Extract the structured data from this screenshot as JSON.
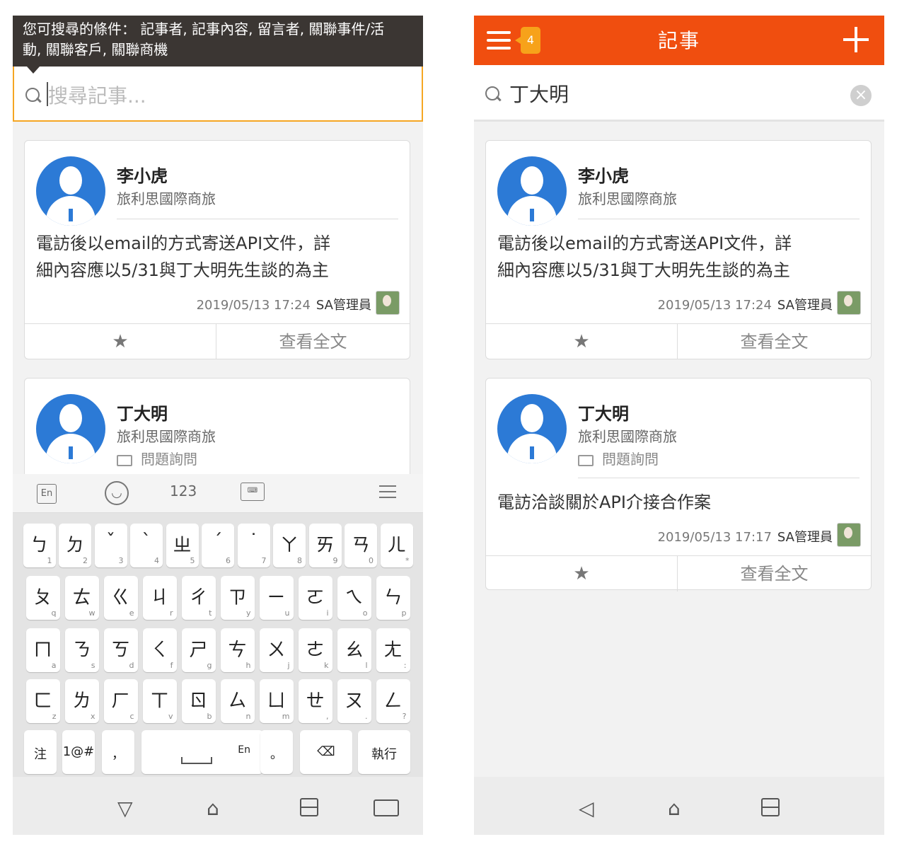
{
  "tooltip": {
    "line1": "您可搜尋的條件： 記事者, 記事內容, 留言者, 關聯事件/活",
    "line2": "動, 關聯客戶, 關聯商機"
  },
  "appbar": {
    "title": "記事",
    "badge_count": "4"
  },
  "search": {
    "placeholder": "搜尋記事...",
    "value": "丁大明"
  },
  "cards": [
    {
      "name": "李小虎",
      "company": "旅利思國際商旅",
      "content_line1": "電訪後以email的方式寄送API文件，詳",
      "content_line2": "細內容應以5/31與丁大明先生談的為主",
      "timestamp": "2019/05/13 17:24",
      "author": "SA管理員",
      "view_all": "查看全文"
    },
    {
      "name": "丁大明",
      "company": "旅利思國際商旅",
      "category": "問題詢問",
      "content_line1": "電訪洽談關於API介接合作案",
      "timestamp": "2019/05/13 17:17",
      "author": "SA管理員",
      "view_all": "查看全文"
    }
  ],
  "keyboard": {
    "toolbar": {
      "en": "En",
      "numbers": "123"
    },
    "rows": [
      [
        [
          "ㄅ",
          "1"
        ],
        [
          "ㄉ",
          "2"
        ],
        [
          "ˇ",
          "3"
        ],
        [
          "ˋ",
          "4"
        ],
        [
          "ㄓ",
          "5"
        ],
        [
          "ˊ",
          "6"
        ],
        [
          "˙",
          "7"
        ],
        [
          "ㄚ",
          "8"
        ],
        [
          "ㄞ",
          "9"
        ],
        [
          "ㄢ",
          "0"
        ],
        [
          "ㄦ",
          "*"
        ]
      ],
      [
        [
          "ㄆ",
          "q"
        ],
        [
          "ㄊ",
          "w"
        ],
        [
          "ㄍ",
          "e"
        ],
        [
          "ㄐ",
          "r"
        ],
        [
          "ㄔ",
          "t"
        ],
        [
          "ㄗ",
          "y"
        ],
        [
          "ㄧ",
          "u"
        ],
        [
          "ㄛ",
          "i"
        ],
        [
          "ㄟ",
          "o"
        ],
        [
          "ㄣ",
          "p"
        ]
      ],
      [
        [
          "ㄇ",
          "a"
        ],
        [
          "ㄋ",
          "s"
        ],
        [
          "ㄎ",
          "d"
        ],
        [
          "ㄑ",
          "f"
        ],
        [
          "ㄕ",
          "g"
        ],
        [
          "ㄘ",
          "h"
        ],
        [
          "ㄨ",
          "j"
        ],
        [
          "ㄜ",
          "k"
        ],
        [
          "ㄠ",
          "l"
        ],
        [
          "ㄤ",
          ":"
        ]
      ],
      [
        [
          "ㄈ",
          "z"
        ],
        [
          "ㄌ",
          "x"
        ],
        [
          "ㄏ",
          "c"
        ],
        [
          "ㄒ",
          "v"
        ],
        [
          "ㄖ",
          "b"
        ],
        [
          "ㄙ",
          "n"
        ],
        [
          "ㄩ",
          "m"
        ],
        [
          "ㄝ",
          ","
        ],
        [
          "ㄡ",
          "."
        ],
        [
          "ㄥ",
          "?"
        ]
      ]
    ],
    "bottom": {
      "zhuyin": "注",
      "symbols": "1@#",
      "comma": "，",
      "space_lang": "En",
      "period": "。",
      "enter": "執行"
    }
  },
  "icons": {
    "search": "search-icon",
    "clear": "clear-icon",
    "menu": "hamburger-icon",
    "add": "plus-icon",
    "star": "star-icon",
    "folder": "folder-icon",
    "back": "back-icon",
    "home": "home-icon",
    "recents": "recents-icon",
    "keyboard": "keyboard-icon"
  },
  "colors": {
    "accent": "#f04e0f",
    "badge": "#f7a21a",
    "focus_border": "#f5a623",
    "avatar_blue": "#2c7ad6"
  }
}
